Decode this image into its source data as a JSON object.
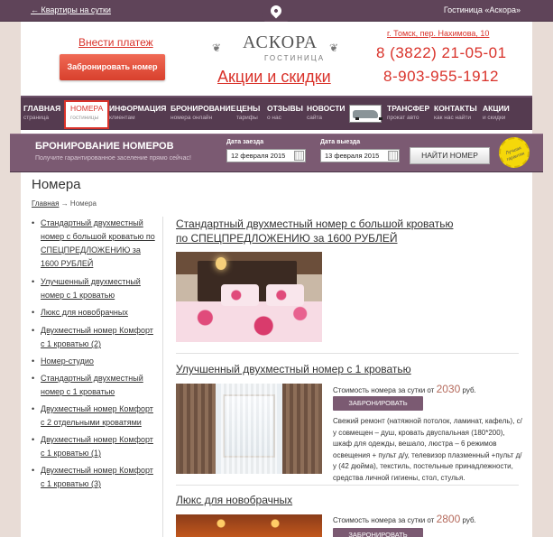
{
  "topbar": {
    "back_link": "← Квартиры на сутки",
    "hotel_name": "Гостиница «Аскора»"
  },
  "header": {
    "pay_link": "Внести платеж",
    "book_button": "Забронировать номер",
    "logo_title": "АСКОРА",
    "logo_subtitle": "ГОСТИНИЦА",
    "promo_link": "Акции и скидки",
    "address": "г. Томск, пер. Нахимова, 10",
    "phone1": "8 (3822) 21-05-01",
    "phone2": "8-903-955-1912"
  },
  "nav": [
    {
      "main": "ГЛАВНАЯ",
      "sub": "страница"
    },
    {
      "main": "НОМЕРА",
      "sub": "гостиницы"
    },
    {
      "main": "ИНФОРМАЦИЯ",
      "sub": "клиентам"
    },
    {
      "main": "БРОНИРОВАНИЕ",
      "sub": "номера онлайн"
    },
    {
      "main": "ЦЕНЫ",
      "sub": "тарифы"
    },
    {
      "main": "ОТЗЫВЫ",
      "sub": "о нас"
    },
    {
      "main": "НОВОСТИ",
      "sub": "сайта"
    },
    {
      "main": "ТРАНСФЕР",
      "sub": "прокат авто"
    },
    {
      "main": "КОНТАКТЫ",
      "sub": "как нас найти"
    },
    {
      "main": "АКЦИИ",
      "sub": "и скидки"
    }
  ],
  "booking": {
    "title": "БРОНИРОВАНИЕ НОМЕРОВ",
    "subtitle": "Получите гарантированное заселение прямо сейчас!",
    "checkin_label": "Дата заезда",
    "checkin_value": "12 февраля 2015",
    "checkout_label": "Дата выезда",
    "checkout_value": "13 февраля 2015",
    "find_button": "НАЙТИ НОМЕР",
    "badge_text": "Лучшая гарантия"
  },
  "page": {
    "title": "Номера",
    "breadcrumb_home": "Главная",
    "breadcrumb_sep": "→",
    "breadcrumb_current": "Номера"
  },
  "sidebar": [
    "Стандартный двухместный номер с большой кроватью по СПЕЦПРЕДЛОЖЕНИЮ за 1600 РУБЛЕЙ",
    "Улучшенный двухместный номер с 1 кроватью",
    "Люкс для новобрачных",
    "Двухместный номер Комфорт с 1 кроватью (2)",
    "Номер-студио",
    "Стандартный двухместный номер с 1 кроватью",
    "Двухместный номер Комфорт с 2 отдельными кроватями",
    "Двухместный номер Комфорт с 1 кроватью (1)",
    "Двухместный номер Комфорт с 1 кроватью (3)"
  ],
  "rooms": [
    {
      "title": "Стандартный двухместный номер с большой кроватью по СПЕЦПРЕДЛОЖЕНИЮ за 1600 РУБЛЕЙ"
    },
    {
      "title": "Улучшенный двухместный номер с 1 кроватью",
      "price_prefix": "Стоимость номера за сутки от",
      "price": "2030",
      "currency": "руб.",
      "book_label": "ЗАБРОНИРОВАТЬ",
      "description": "Свежий ремонт (натяжной потолок, ламинат, кафель), с/у совмещен – душ, кровать двуспальная (180*200), шкаф для одежды, вешало, люстра – 6 режимов освещения + пульт д/у, телевизор плазменный +пульт д/у (42 дюйма), текстиль, постельные принадлежности, средства личной гигиены, стол, стулья."
    },
    {
      "title": "Люкс для новобрачных",
      "price_prefix": "Стоимость номера за сутки от",
      "price": "2800",
      "currency": "руб.",
      "book_label": "ЗАБРОНИРОВАТЬ"
    }
  ]
}
